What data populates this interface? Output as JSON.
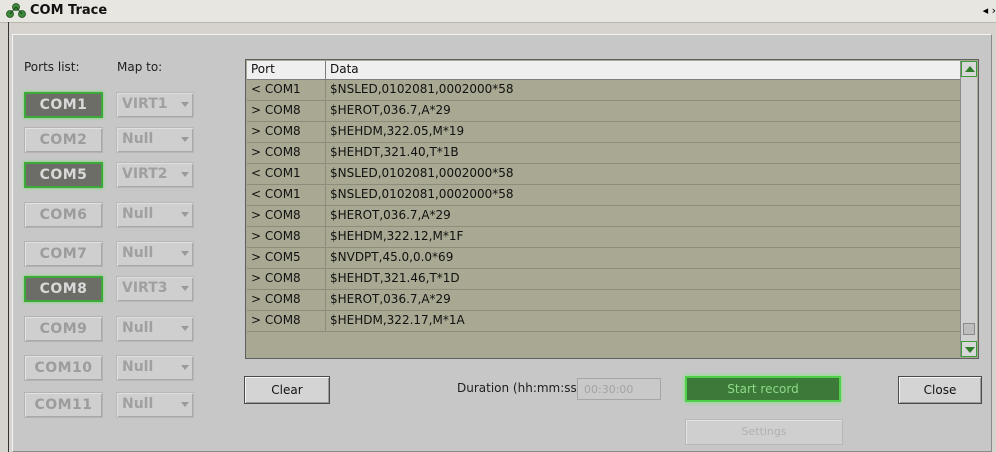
{
  "window": {
    "title": "COM Trace",
    "title_arrows": "◂ ›"
  },
  "ports_panel": {
    "ports_label": "Ports list:",
    "map_label": "Map to:",
    "ports": [
      {
        "name": "COM1",
        "map": "VIRT1",
        "active": true
      },
      {
        "name": "COM2",
        "map": "Null",
        "active": false
      },
      {
        "name": "COM5",
        "map": "VIRT2",
        "active": true
      },
      {
        "name": "COM6",
        "map": "Null",
        "active": false
      },
      {
        "name": "COM7",
        "map": "Null",
        "active": false
      },
      {
        "name": "COM8",
        "map": "VIRT3",
        "active": true
      },
      {
        "name": "COM9",
        "map": "Null",
        "active": false
      },
      {
        "name": "COM10",
        "map": "Null",
        "active": false
      },
      {
        "name": "COM11",
        "map": "Null",
        "active": false
      }
    ]
  },
  "trace_table": {
    "columns": [
      "Port",
      "Data"
    ],
    "rows": [
      {
        "port": "< COM1",
        "data": "$NSLED,0102081,0002000*58"
      },
      {
        "port": "> COM8",
        "data": "$HEROT,036.7,A*29"
      },
      {
        "port": "> COM8",
        "data": "$HEHDM,322.05,M*19"
      },
      {
        "port": "> COM8",
        "data": "$HEHDT,321.40,T*1B"
      },
      {
        "port": "< COM1",
        "data": "$NSLED,0102081,0002000*58"
      },
      {
        "port": "< COM1",
        "data": "$NSLED,0102081,0002000*58"
      },
      {
        "port": "> COM8",
        "data": "$HEROT,036.7,A*29"
      },
      {
        "port": "> COM8",
        "data": "$HEHDM,322.12,M*1F"
      },
      {
        "port": "> COM5",
        "data": "$NVDPT,45.0,0.0*69"
      },
      {
        "port": "> COM8",
        "data": "$HEHDT,321.46,T*1D"
      },
      {
        "port": "> COM8",
        "data": "$HEROT,036.7,A*29"
      },
      {
        "port": "> COM8",
        "data": "$HEHDM,322.17,M*1A"
      }
    ]
  },
  "controls": {
    "clear_label": "Clear",
    "duration_label": "Duration (hh:mm:ss):",
    "duration_value": "00:30:00",
    "start_label": "Start record",
    "close_label": "Close",
    "settings_label": "Settings"
  },
  "colors": {
    "active_border": "#3fa83a",
    "start_button": "#3d7a3a",
    "table_bg": "#a9a892"
  }
}
